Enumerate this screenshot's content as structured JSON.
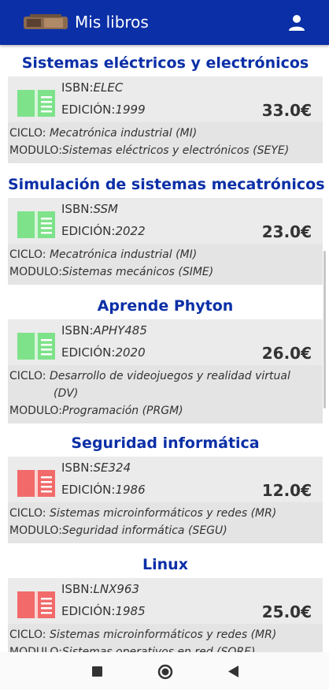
{
  "appbar": {
    "title": "Mis libros"
  },
  "books": [
    {
      "title": "Sistemas eléctricos y electrónicos",
      "isbn_label": "ISBN:",
      "isbn": "ELEC",
      "edicion_label": "EDICIÓN:",
      "edicion": "1999",
      "price": "33.0€",
      "ciclo_label": "CICLO:",
      "ciclo": "Mecatrónica industrial (MI)",
      "modulo_label": "MODULO:",
      "modulo": "Sistemas eléctricos y electrónicos (SEYE)",
      "icon_color": "#7ee28a"
    },
    {
      "title": "Simulación de sistemas mecatrónicos",
      "isbn_label": "ISBN:",
      "isbn": "SSM",
      "edicion_label": "EDICIÓN:",
      "edicion": "2022",
      "price": "23.0€",
      "ciclo_label": "CICLO:",
      "ciclo": "Mecatrónica industrial (MI)",
      "modulo_label": "MODULO:",
      "modulo": "Sistemas mecánicos (SIME)",
      "icon_color": "#7ee28a"
    },
    {
      "title": "Aprende Phyton",
      "isbn_label": "ISBN:",
      "isbn": "APHY485",
      "edicion_label": "EDICIÓN:",
      "edicion": "2020",
      "price": "26.0€",
      "ciclo_label": "CICLO:",
      "ciclo": "Desarrollo de videojuegos y realidad virtual",
      "ciclo_cont": "(DV)",
      "modulo_label": "MODULO:",
      "modulo": "Programación (PRGM)",
      "icon_color": "#7ee28a"
    },
    {
      "title": "Seguridad informática",
      "isbn_label": "ISBN:",
      "isbn": "SE324",
      "edicion_label": "EDICIÓN:",
      "edicion": "1986",
      "price": "12.0€",
      "ciclo_label": "CICLO:",
      "ciclo": "Sistemas microinformáticos y redes (MR)",
      "modulo_label": "MODULO:",
      "modulo": "Seguridad informática (SEGU)",
      "icon_color": "#f26a6a"
    },
    {
      "title": "Linux",
      "isbn_label": "ISBN:",
      "isbn": "LNX963",
      "edicion_label": "EDICIÓN:",
      "edicion": "1985",
      "price": "25.0€",
      "ciclo_label": "CICLO:",
      "ciclo": "Sistemas microinformáticos y redes (MR)",
      "modulo_label": "MODULO:",
      "modulo": "Sistemas operativos en red (SORE)",
      "icon_color": "#f26a6a"
    }
  ],
  "icons": {
    "profile": "person-icon",
    "book": "book-icon",
    "nav_recent": "square-icon",
    "nav_home": "circle-icon",
    "nav_back": "triangle-back-icon"
  },
  "colors": {
    "appbar": "#0b2fa7",
    "title": "#0b2fa7",
    "green_book": "#7ee28a",
    "red_book": "#f26a6a"
  }
}
